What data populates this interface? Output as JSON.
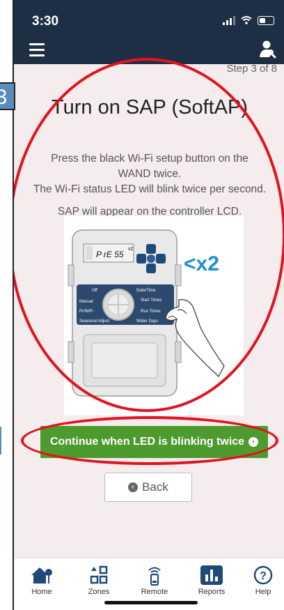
{
  "status_bar": {
    "time": "3:30"
  },
  "header": {
    "menu_icon": "hamburger-icon",
    "user_icon": "user-wrench-icon"
  },
  "step": {
    "label": "Step 3 of 8",
    "annotation_number": "3"
  },
  "title": "Turn on SAP (SoftAP)",
  "instructions": [
    "Press the black Wi-Fi setup button on the WAND twice.",
    "The Wi-Fi status LED will blink twice per second.",
    "SAP will appear on the controller LCD."
  ],
  "illustration": {
    "lcd_text": "P rE 55",
    "lcd_superscript": "x2",
    "callout": "<x2",
    "dial_labels": [
      "Off",
      "Manual",
      "Pr/WiFi",
      "Seasonal Adjust"
    ],
    "right_labels": [
      "Date/Time",
      "Start Times",
      "Run Times",
      "Water Days"
    ]
  },
  "buttons": {
    "continue_label": "Continue when LED is blinking twice",
    "back_label": "Back"
  },
  "bottom_nav": [
    {
      "label": "Home",
      "icon": "home-icon"
    },
    {
      "label": "Zones",
      "icon": "zones-icon"
    },
    {
      "label": "Remote",
      "icon": "remote-icon"
    },
    {
      "label": "Reports",
      "icon": "reports-icon"
    },
    {
      "label": "Help",
      "icon": "help-icon"
    }
  ],
  "colors": {
    "header_bg": "#1e2e44",
    "accent_green": "#4d9a2e",
    "annotation_red": "#e0141e",
    "nav_blue": "#1f4a78"
  }
}
